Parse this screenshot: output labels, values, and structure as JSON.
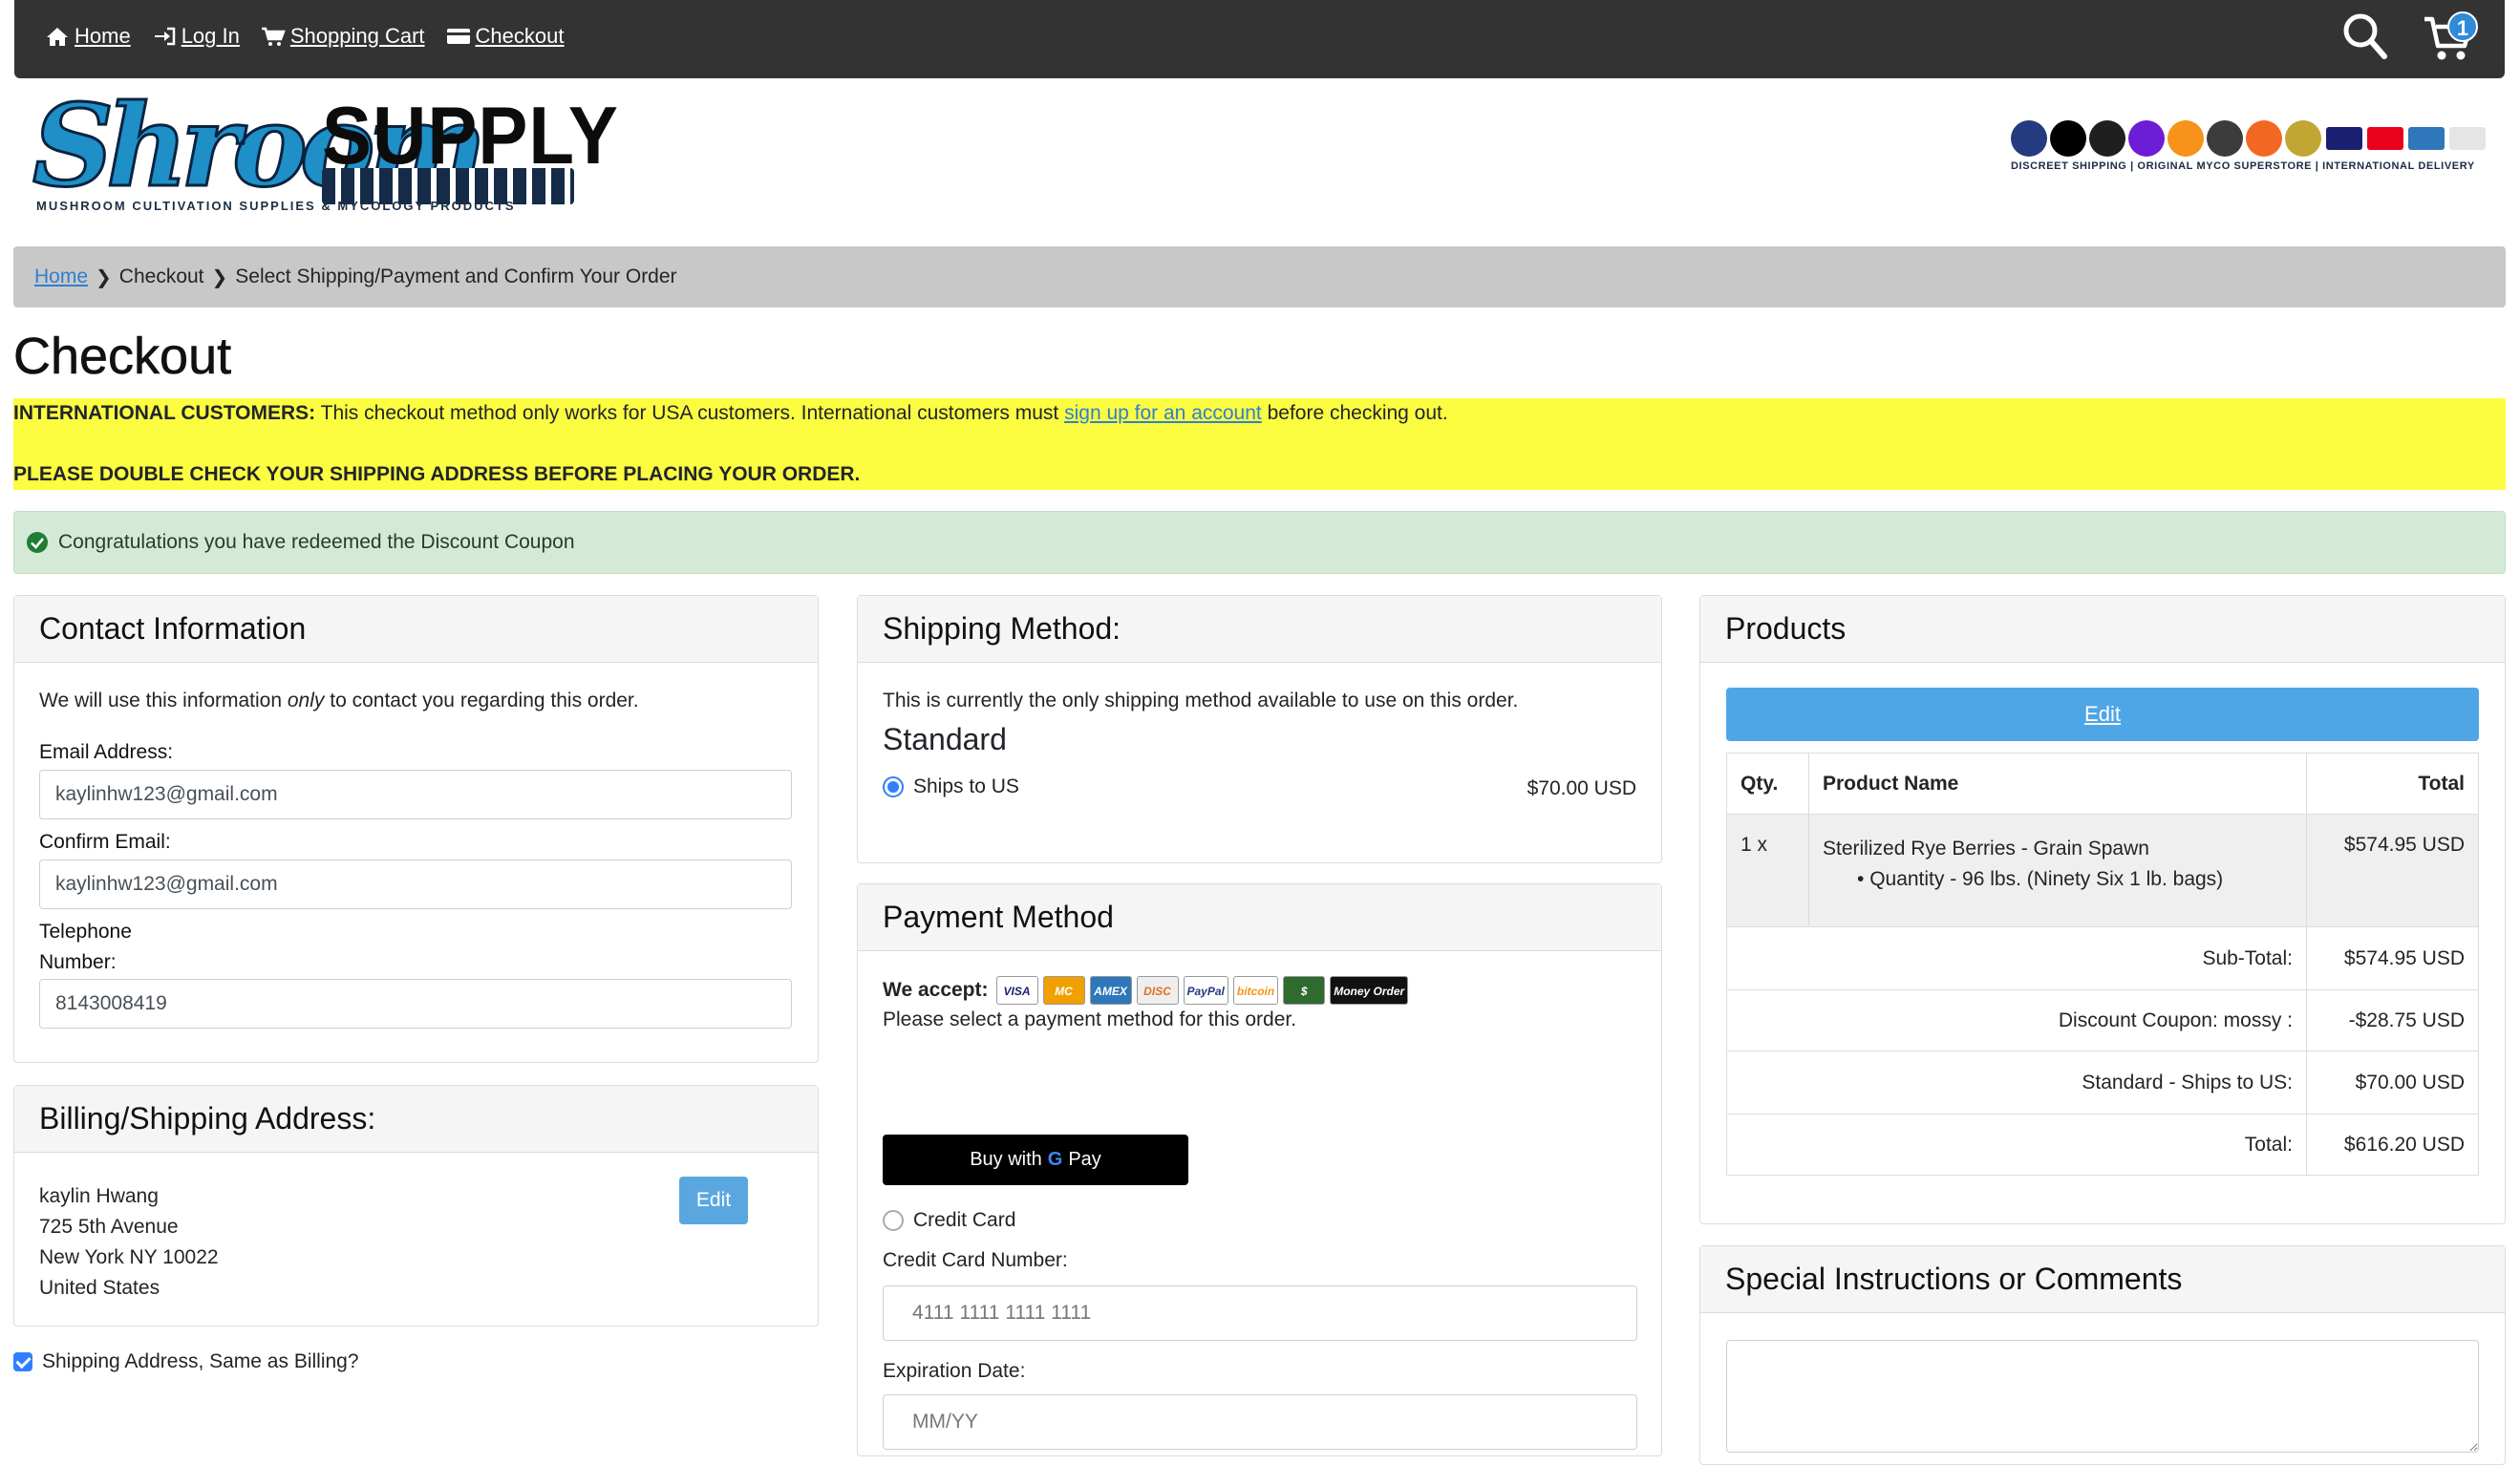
{
  "nav": {
    "links": [
      {
        "label": "Home",
        "icon": "home-icon"
      },
      {
        "label": "Log In",
        "icon": "login-icon"
      },
      {
        "label": "Shopping Cart",
        "icon": "cart-icon"
      },
      {
        "label": "Checkout",
        "icon": "credit-card-icon"
      }
    ],
    "cart_count": "1"
  },
  "logo": {
    "script_text": "Shroom",
    "supply_text": "SUPPLY",
    "tagline": "MUSHROOM CULTIVATION SUPPLIES & MYCOLOGY PRODUCTS"
  },
  "payment_strip": {
    "tagline": "DISCREET SHIPPING | ORIGINAL MYCO SUPERSTORE | INTERNATIONAL DELIVERY",
    "coin_colors": [
      "#253b80",
      "#000000",
      "#1f1f1f",
      "#6d1ed4",
      "#f7931a",
      "#3c3c3d",
      "#f26822",
      "#c2a633"
    ]
  },
  "breadcrumb": {
    "home": "Home",
    "checkout": "Checkout",
    "current": "Select Shipping/Payment and Confirm Your Order"
  },
  "page_title": "Checkout",
  "notice": {
    "intl_label": "INTERNATIONAL CUSTOMERS:",
    "intl_text": " This checkout method only works for USA customers. International customers must ",
    "intl_link": "sign up for an account",
    "intl_after": " before checking out.",
    "double_check": "PLEASE DOUBLE CHECK YOUR SHIPPING ADDRESS BEFORE PLACING YOUR ORDER."
  },
  "success_message": "Congratulations you have redeemed the Discount Coupon",
  "contact": {
    "heading": "Contact Information",
    "intro_before": "We will use this information ",
    "intro_em": "only",
    "intro_after": " to contact you regarding this order.",
    "email_label": "Email Address:",
    "email_value": "kaylinhw123@gmail.com",
    "confirm_label": "Confirm Email:",
    "confirm_value": "kaylinhw123@gmail.com",
    "phone_label_1": "Telephone",
    "phone_label_2": "Number:",
    "phone_value": "8143008419"
  },
  "billing": {
    "heading": "Billing/Shipping Address:",
    "edit_label": "Edit",
    "name": "kaylin Hwang",
    "street": "725 5th Avenue",
    "city": "New York NY 10022",
    "country": "United States",
    "same_label": "Shipping Address, Same as Billing?"
  },
  "shipping": {
    "heading": "Shipping Method:",
    "intro": "This is currently the only shipping method available to use on this order.",
    "method_title": "Standard",
    "option_label": "Ships to US",
    "option_price": "$70.00 USD"
  },
  "payment": {
    "heading": "Payment Method",
    "accept_label": "We accept:",
    "select_text": "Please select a payment method for this order.",
    "gpay_label": "Buy with",
    "gpay_brand": "Pay",
    "credit_card_label": "Credit Card",
    "cc_number_label": "Credit Card Number:",
    "cc_number_placeholder": "4111 1111 1111 1111",
    "expiry_label": "Expiration Date:",
    "expiry_placeholder": "MM/YY",
    "card_logos": [
      "VISA",
      "MC",
      "AMEX",
      "DISC",
      "PayPal",
      "bitcoin",
      "$",
      "Money Order"
    ]
  },
  "products": {
    "heading": "Products",
    "edit_label": "Edit",
    "columns": [
      "Qty.",
      "Product Name",
      "Total"
    ],
    "rows": [
      {
        "qty": "1 x",
        "name": "Sterilized Rye Berries - Grain Spawn",
        "attr": "Quantity - 96 lbs. (Ninety Six 1 lb. bags)",
        "total": "$574.95 USD"
      }
    ],
    "totals": [
      {
        "label": "Sub-Total:",
        "value": "$574.95 USD"
      },
      {
        "label": "Discount Coupon: mossy :",
        "value": "-$28.75 USD"
      },
      {
        "label": "Standard - Ships to US:",
        "value": "$70.00 USD"
      },
      {
        "label": "Total:",
        "value": "$616.20 USD"
      }
    ]
  },
  "comments": {
    "heading": "Special Instructions or Comments"
  }
}
